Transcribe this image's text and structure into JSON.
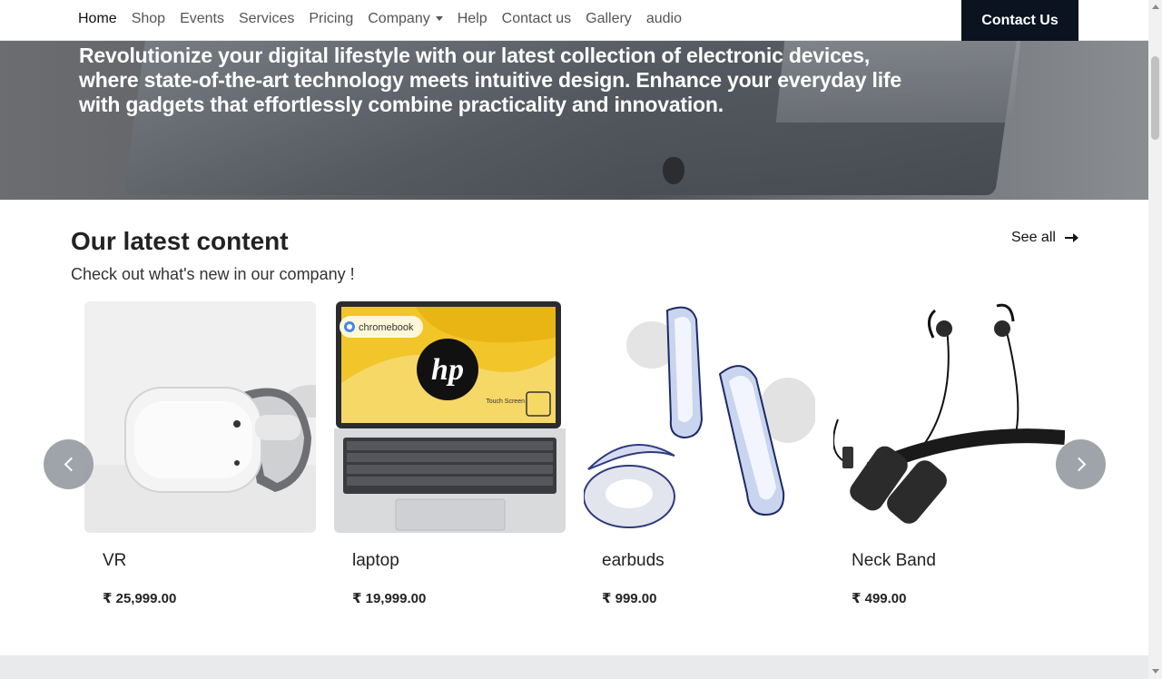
{
  "nav": {
    "links": [
      {
        "label": "Home"
      },
      {
        "label": "Shop"
      },
      {
        "label": "Events"
      },
      {
        "label": "Services"
      },
      {
        "label": "Pricing"
      },
      {
        "label": "Company"
      },
      {
        "label": "Help"
      },
      {
        "label": "Contact us"
      },
      {
        "label": "Gallery"
      },
      {
        "label": "audio"
      }
    ],
    "active": "Home",
    "cta": "Contact Us"
  },
  "hero": {
    "text": "Revolutionize your digital lifestyle with our latest collection of electronic devices, where state-of-the-art technology meets intuitive design. Enhance your everyday life with gadgets that effortlessly combine practicality and innovation."
  },
  "section": {
    "title": "Our latest content",
    "subtitle": "Check out what's new in our company !",
    "see_all": "See all"
  },
  "products": [
    {
      "name": "VR",
      "price": "₹ 25,999.00"
    },
    {
      "name": "laptop",
      "price": "₹ 19,999.00"
    },
    {
      "name": "earbuds",
      "price": "₹ 999.00"
    },
    {
      "name": "Neck Band",
      "price": "₹ 499.00"
    }
  ],
  "laptop_screen": {
    "badge": "chromebook",
    "logo": "hp",
    "touch": "Touch Screen"
  },
  "colors": {
    "cta_bg": "#0b1320",
    "carousel_control": "#9aa0a6"
  }
}
